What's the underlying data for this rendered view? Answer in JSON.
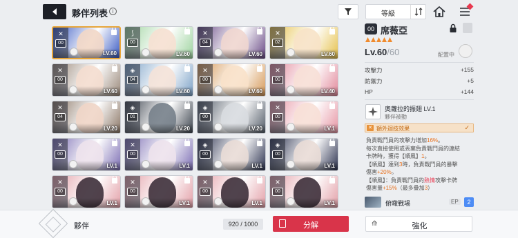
{
  "header": {
    "title": "夥伴列表",
    "info_icon": "i",
    "sort_label": "等級",
    "sort_direction_icon": "↓↑"
  },
  "cards": [
    {
      "slot": "00",
      "level": "LV.60",
      "role": "sword",
      "bg": "#3c5cc4",
      "face": "#f2d7c6",
      "selected": true
    },
    {
      "slot": "00",
      "level": "LV.60",
      "role": "bow",
      "bg": "#9fd4a0",
      "face": "#f6e0d2",
      "selected": false
    },
    {
      "slot": "04",
      "level": "LV.60",
      "role": "sword",
      "bg": "#6a4b86",
      "face": "#efd6cf",
      "selected": false
    },
    {
      "slot": "02",
      "level": "LV.60",
      "role": "sword",
      "bg": "#e6c14d",
      "face": "#f7e2c7",
      "selected": false
    },
    {
      "slot": "00",
      "level": "LV.60",
      "role": "sword",
      "bg": "#9b8a7c",
      "face": "#f4ddcf",
      "selected": false
    },
    {
      "slot": "04",
      "level": "LV.60",
      "role": "shield",
      "bg": "#7ea3c8",
      "face": "#f4e2d8",
      "selected": false
    },
    {
      "slot": "00",
      "level": "LV.60",
      "role": "sword",
      "bg": "#d69a5a",
      "face": "#f8e1c9",
      "selected": false
    },
    {
      "slot": "00",
      "level": "LV.40",
      "role": "sword",
      "bg": "#e28a9c",
      "face": "#f7dfd6",
      "selected": false
    },
    {
      "slot": "04",
      "level": "LV.20",
      "role": "sword",
      "bg": "#8c7868",
      "face": "#f0d5c6",
      "selected": false
    },
    {
      "slot": "01",
      "level": "LV.20",
      "role": "shield",
      "bg": "#3f4650",
      "face": "#767f8a",
      "selected": false
    },
    {
      "slot": "00",
      "level": "LV.20",
      "role": "shield",
      "bg": "#555e6a",
      "face": "#d8dbe0",
      "selected": false
    },
    {
      "slot": "00",
      "level": "LV.1",
      "role": "sword",
      "bg": "#e797a5",
      "face": "#f7dfd6",
      "selected": false
    },
    {
      "slot": "00",
      "level": "LV.1",
      "role": "sword",
      "bg": "#7d6fb4",
      "face": "#ede2ec",
      "selected": false
    },
    {
      "slot": "00",
      "level": "LV.1",
      "role": "sword",
      "bg": "#7d6fb4",
      "face": "#ede2ec",
      "selected": false
    },
    {
      "slot": "00",
      "level": "LV.1",
      "role": "shield",
      "bg": "#2f3552",
      "face": "#e9dcd6",
      "selected": false
    },
    {
      "slot": "00",
      "level": "LV.1",
      "role": "shield",
      "bg": "#2f3552",
      "face": "#e9dcd6",
      "selected": false
    },
    {
      "slot": "00",
      "level": "LV.1",
      "role": "sword",
      "bg": "#e3a0a8",
      "face": "#3d2f3a",
      "selected": false
    },
    {
      "slot": "00",
      "level": "LV.1",
      "role": "sword",
      "bg": "#e3a0a8",
      "face": "#3d2f3a",
      "selected": false
    },
    {
      "slot": "00",
      "level": "LV.1",
      "role": "sword",
      "bg": "#e3a0a8",
      "face": "#3d2f3a",
      "selected": false
    },
    {
      "slot": "00",
      "level": "LV.1",
      "role": "sword",
      "bg": "#e3a0a8",
      "face": "#3d2f3a",
      "selected": false
    }
  ],
  "detail": {
    "slot": "00",
    "name": "席薇亞",
    "star_count": 5,
    "level_current": "Lv.60",
    "level_max": "/60",
    "equip_label": "配置中",
    "stats": [
      {
        "label": "攻擊力",
        "value": "+155"
      },
      {
        "label": "防禦力",
        "value": "+5"
      },
      {
        "label": "HP",
        "value": "+144"
      }
    ],
    "skill_name": "奧蘿拉的振翅 LV.1",
    "skill_type": "夥伴被動",
    "extra_label": "額外迴技效果",
    "desc_lines": [
      {
        "parts": [
          {
            "t": "負責戰鬥員的攻擊力增加"
          },
          {
            "t": "16%",
            "c": "hl"
          },
          {
            "t": "。"
          }
        ]
      },
      {
        "parts": [
          {
            "t": "每次直接使用或丟棄負責戰鬥員的連結"
          }
        ]
      },
      {
        "parts": [
          {
            "t": "卡牌時，獲得【順風】"
          },
          {
            "t": "1",
            "c": "hl"
          },
          {
            "t": "。"
          }
        ]
      },
      {
        "parts": [
          {
            "t": "【順風】達到"
          },
          {
            "t": "3",
            "c": "hl"
          },
          {
            "t": "時，負責戰鬥員的暴擊"
          }
        ]
      },
      {
        "parts": [
          {
            "t": "傷害"
          },
          {
            "t": "+20%",
            "c": "hl"
          },
          {
            "t": "。"
          }
        ]
      },
      {
        "parts": [
          {
            "t": "【順風】：負責戰鬥員的"
          },
          {
            "t": "熱情",
            "c": "hr"
          },
          {
            "t": "攻擊卡牌"
          }
        ]
      },
      {
        "parts": [
          {
            "t": "傷害量"
          },
          {
            "t": "+15%",
            "c": "hl"
          },
          {
            "t": "（最多疊加"
          },
          {
            "t": "3",
            "c": "hl"
          },
          {
            "t": "）"
          }
        ]
      }
    ],
    "ep_name": "俯瞰戰場",
    "ep_label": "EP",
    "ep_value": "2"
  },
  "bottom": {
    "title": "夥伴",
    "count": "920 / 1000",
    "dismantle_label": "分解",
    "enhance_label": "強化"
  },
  "colors": {
    "accent_orange": "#e86f1a",
    "danger_red": "#d9344a",
    "selection_gold": "#e8a63a"
  }
}
